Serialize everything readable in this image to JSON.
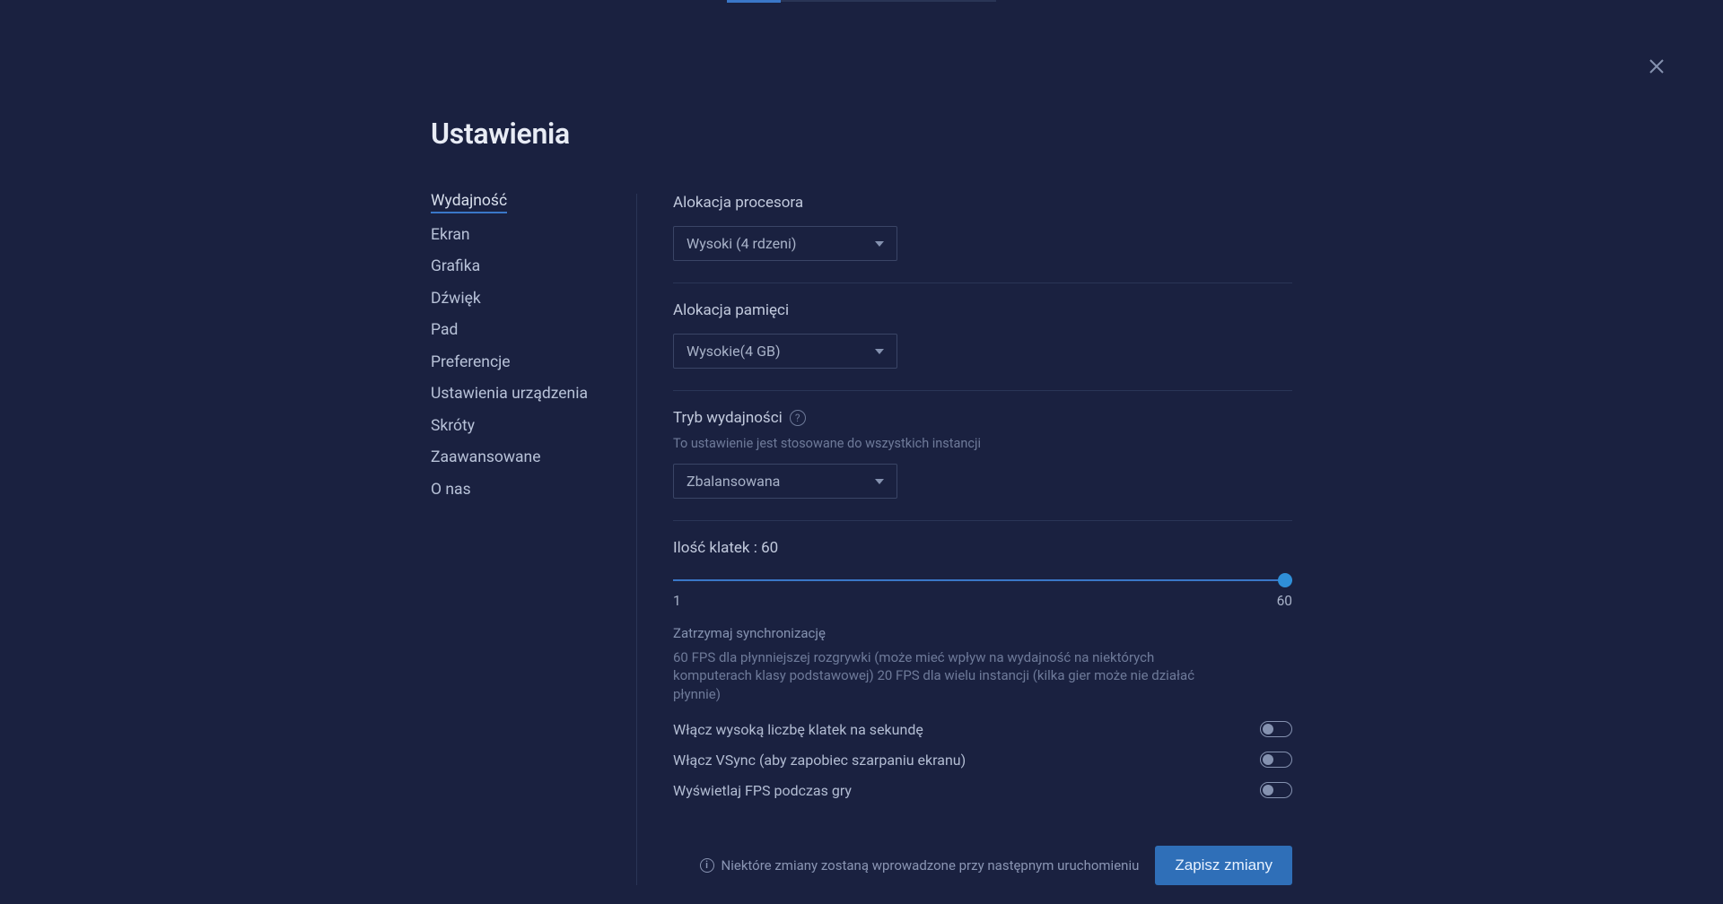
{
  "title": "Ustawienia",
  "sidebar": {
    "items": [
      {
        "label": "Wydajność",
        "active": true
      },
      {
        "label": "Ekran"
      },
      {
        "label": "Grafika"
      },
      {
        "label": "Dźwięk"
      },
      {
        "label": "Pad"
      },
      {
        "label": "Preferencje"
      },
      {
        "label": "Ustawienia urządzenia"
      },
      {
        "label": "Skróty"
      },
      {
        "label": "Zaawansowane"
      },
      {
        "label": "O nas"
      }
    ]
  },
  "cpu": {
    "label": "Alokacja procesora",
    "value": "Wysoki (4 rdzeni)"
  },
  "memory": {
    "label": "Alokacja pamięci",
    "value": "Wysokie(4 GB)"
  },
  "perfmode": {
    "label": "Tryb wydajności",
    "sub": "To ustawienie jest stosowane do wszystkich instancji",
    "value": "Zbalansowana"
  },
  "fps": {
    "label": "Ilość klatek : 60",
    "min": "1",
    "max": "60",
    "syncTitle": "Zatrzymaj synchronizację",
    "desc": "60 FPS dla płynniejszej rozgrywki (może mieć wpływ na wydajność na niektórych komputerach klasy podstawowej) 20 FPS dla wielu instancji (kilka gier może nie działać płynnie)"
  },
  "toggles": {
    "highfps": "Włącz wysoką liczbę klatek na sekundę",
    "vsync": "Włącz VSync (aby zapobiec szarpaniu ekranu)",
    "showfps": "Wyświetlaj FPS podczas gry"
  },
  "footer": {
    "info": "Niektóre zmiany zostaną wprowadzone przy następnym uruchomieniu",
    "save": "Zapisz zmiany"
  }
}
